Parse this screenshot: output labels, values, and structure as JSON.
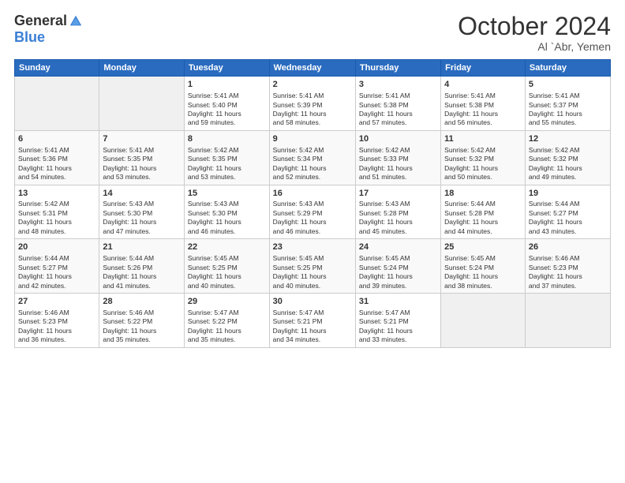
{
  "logo": {
    "general": "General",
    "blue": "Blue"
  },
  "title": {
    "month": "October 2024",
    "location": "Al `Abr, Yemen"
  },
  "headers": [
    "Sunday",
    "Monday",
    "Tuesday",
    "Wednesday",
    "Thursday",
    "Friday",
    "Saturday"
  ],
  "weeks": [
    [
      {
        "day": "",
        "info": ""
      },
      {
        "day": "",
        "info": ""
      },
      {
        "day": "1",
        "info": "Sunrise: 5:41 AM\nSunset: 5:40 PM\nDaylight: 11 hours\nand 59 minutes."
      },
      {
        "day": "2",
        "info": "Sunrise: 5:41 AM\nSunset: 5:39 PM\nDaylight: 11 hours\nand 58 minutes."
      },
      {
        "day": "3",
        "info": "Sunrise: 5:41 AM\nSunset: 5:38 PM\nDaylight: 11 hours\nand 57 minutes."
      },
      {
        "day": "4",
        "info": "Sunrise: 5:41 AM\nSunset: 5:38 PM\nDaylight: 11 hours\nand 56 minutes."
      },
      {
        "day": "5",
        "info": "Sunrise: 5:41 AM\nSunset: 5:37 PM\nDaylight: 11 hours\nand 55 minutes."
      }
    ],
    [
      {
        "day": "6",
        "info": "Sunrise: 5:41 AM\nSunset: 5:36 PM\nDaylight: 11 hours\nand 54 minutes."
      },
      {
        "day": "7",
        "info": "Sunrise: 5:41 AM\nSunset: 5:35 PM\nDaylight: 11 hours\nand 53 minutes."
      },
      {
        "day": "8",
        "info": "Sunrise: 5:42 AM\nSunset: 5:35 PM\nDaylight: 11 hours\nand 53 minutes."
      },
      {
        "day": "9",
        "info": "Sunrise: 5:42 AM\nSunset: 5:34 PM\nDaylight: 11 hours\nand 52 minutes."
      },
      {
        "day": "10",
        "info": "Sunrise: 5:42 AM\nSunset: 5:33 PM\nDaylight: 11 hours\nand 51 minutes."
      },
      {
        "day": "11",
        "info": "Sunrise: 5:42 AM\nSunset: 5:32 PM\nDaylight: 11 hours\nand 50 minutes."
      },
      {
        "day": "12",
        "info": "Sunrise: 5:42 AM\nSunset: 5:32 PM\nDaylight: 11 hours\nand 49 minutes."
      }
    ],
    [
      {
        "day": "13",
        "info": "Sunrise: 5:42 AM\nSunset: 5:31 PM\nDaylight: 11 hours\nand 48 minutes."
      },
      {
        "day": "14",
        "info": "Sunrise: 5:43 AM\nSunset: 5:30 PM\nDaylight: 11 hours\nand 47 minutes."
      },
      {
        "day": "15",
        "info": "Sunrise: 5:43 AM\nSunset: 5:30 PM\nDaylight: 11 hours\nand 46 minutes."
      },
      {
        "day": "16",
        "info": "Sunrise: 5:43 AM\nSunset: 5:29 PM\nDaylight: 11 hours\nand 46 minutes."
      },
      {
        "day": "17",
        "info": "Sunrise: 5:43 AM\nSunset: 5:28 PM\nDaylight: 11 hours\nand 45 minutes."
      },
      {
        "day": "18",
        "info": "Sunrise: 5:44 AM\nSunset: 5:28 PM\nDaylight: 11 hours\nand 44 minutes."
      },
      {
        "day": "19",
        "info": "Sunrise: 5:44 AM\nSunset: 5:27 PM\nDaylight: 11 hours\nand 43 minutes."
      }
    ],
    [
      {
        "day": "20",
        "info": "Sunrise: 5:44 AM\nSunset: 5:27 PM\nDaylight: 11 hours\nand 42 minutes."
      },
      {
        "day": "21",
        "info": "Sunrise: 5:44 AM\nSunset: 5:26 PM\nDaylight: 11 hours\nand 41 minutes."
      },
      {
        "day": "22",
        "info": "Sunrise: 5:45 AM\nSunset: 5:25 PM\nDaylight: 11 hours\nand 40 minutes."
      },
      {
        "day": "23",
        "info": "Sunrise: 5:45 AM\nSunset: 5:25 PM\nDaylight: 11 hours\nand 40 minutes."
      },
      {
        "day": "24",
        "info": "Sunrise: 5:45 AM\nSunset: 5:24 PM\nDaylight: 11 hours\nand 39 minutes."
      },
      {
        "day": "25",
        "info": "Sunrise: 5:45 AM\nSunset: 5:24 PM\nDaylight: 11 hours\nand 38 minutes."
      },
      {
        "day": "26",
        "info": "Sunrise: 5:46 AM\nSunset: 5:23 PM\nDaylight: 11 hours\nand 37 minutes."
      }
    ],
    [
      {
        "day": "27",
        "info": "Sunrise: 5:46 AM\nSunset: 5:23 PM\nDaylight: 11 hours\nand 36 minutes."
      },
      {
        "day": "28",
        "info": "Sunrise: 5:46 AM\nSunset: 5:22 PM\nDaylight: 11 hours\nand 35 minutes."
      },
      {
        "day": "29",
        "info": "Sunrise: 5:47 AM\nSunset: 5:22 PM\nDaylight: 11 hours\nand 35 minutes."
      },
      {
        "day": "30",
        "info": "Sunrise: 5:47 AM\nSunset: 5:21 PM\nDaylight: 11 hours\nand 34 minutes."
      },
      {
        "day": "31",
        "info": "Sunrise: 5:47 AM\nSunset: 5:21 PM\nDaylight: 11 hours\nand 33 minutes."
      },
      {
        "day": "",
        "info": ""
      },
      {
        "day": "",
        "info": ""
      }
    ]
  ]
}
